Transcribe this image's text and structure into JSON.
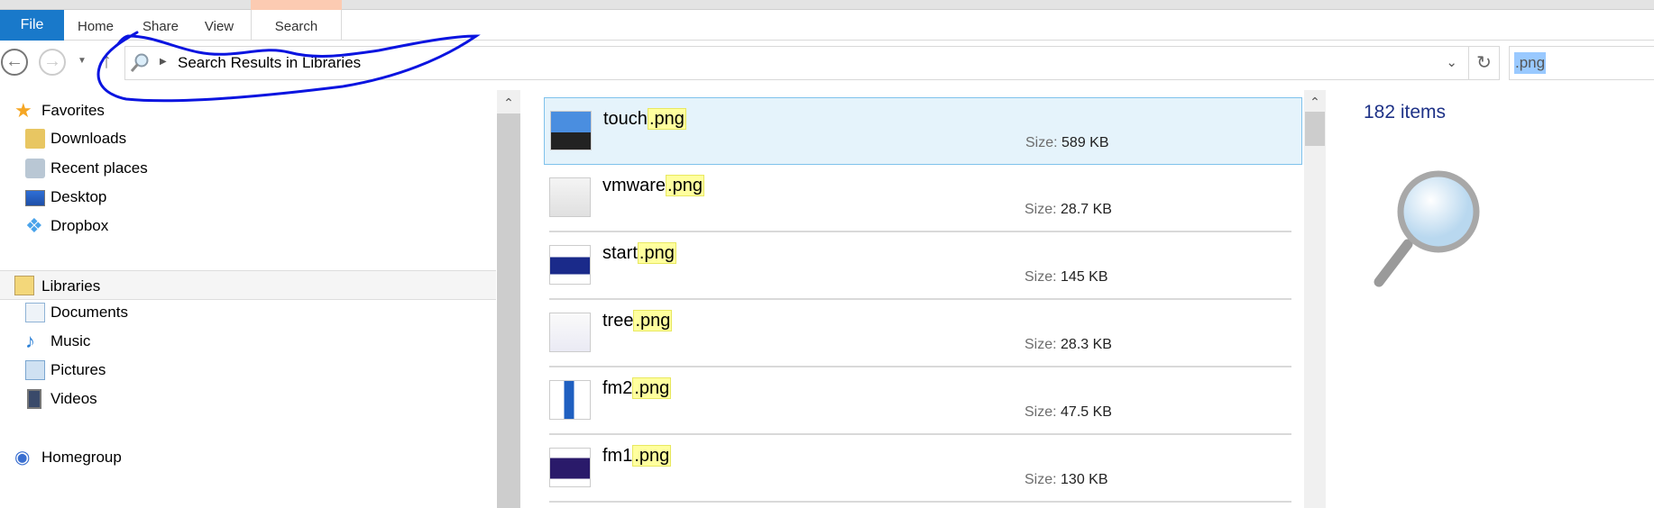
{
  "ribbon": {
    "tabs": [
      "File",
      "Home",
      "Share",
      "View",
      "Search"
    ],
    "accent": "#1979ca",
    "context_color": "#fccbb2"
  },
  "address": {
    "path": "Search Results in Libraries",
    "back_icon": "arrow-left-icon",
    "forward_icon": "arrow-right-icon",
    "up_icon": "arrow-up-icon",
    "refresh_icon": "refresh-icon"
  },
  "search": {
    "value": ".png"
  },
  "nav": {
    "favorites": {
      "label": "Favorites",
      "items": [
        "Downloads",
        "Recent places",
        "Desktop",
        "Dropbox"
      ]
    },
    "libraries": {
      "label": "Libraries",
      "items": [
        "Documents",
        "Music",
        "Pictures",
        "Videos"
      ]
    },
    "homegroup": {
      "label": "Homegroup"
    }
  },
  "files": [
    {
      "base": "touch",
      "ext": ".png",
      "size_label": "Size:",
      "size": "589 KB",
      "selected": true
    },
    {
      "base": "vmware",
      "ext": ".png",
      "size_label": "Size:",
      "size": "28.7 KB"
    },
    {
      "base": "start",
      "ext": ".png",
      "size_label": "Size:",
      "size": "145 KB"
    },
    {
      "base": "tree",
      "ext": ".png",
      "size_label": "Size:",
      "size": "28.3 KB"
    },
    {
      "base": "fm2",
      "ext": ".png",
      "size_label": "Size:",
      "size": "47.5 KB"
    },
    {
      "base": "fm1",
      "ext": ".png",
      "size_label": "Size:",
      "size": "130 KB"
    }
  ],
  "details": {
    "count": "182 items"
  },
  "annotation_color": "#0a14e0"
}
